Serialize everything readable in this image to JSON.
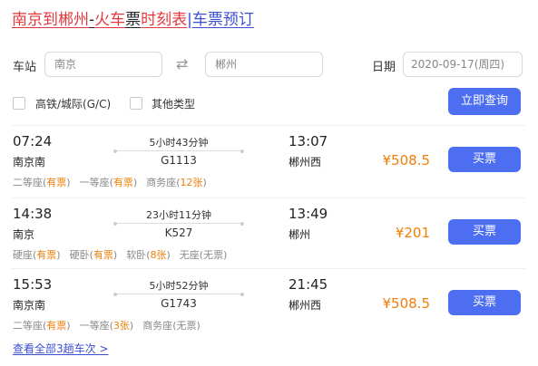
{
  "title": {
    "from": "南京到郴州",
    "dash": "-",
    "huoche": "火车",
    "piao": "票",
    "shikebiao": "时刻表",
    "pipe": "|",
    "booking": "车票预订"
  },
  "search": {
    "station_label": "车站",
    "from_value": "南京",
    "to_value": "郴州",
    "date_label": "日期",
    "date_value": "2020-09-17(周四)",
    "filter_gc": "高铁/城际(G/C)",
    "filter_other": "其他类型",
    "query_button": "立即查询"
  },
  "trains": [
    {
      "depart_time": "07:24",
      "depart_station": "南京南",
      "duration": "5小时43分钟",
      "number": "G1113",
      "arrive_time": "13:07",
      "arrive_station": "郴州西",
      "price": "¥508.5",
      "buy_label": "买票",
      "seats": [
        {
          "name": "二等座",
          "status": "有票"
        },
        {
          "name": "一等座",
          "status": "有票"
        },
        {
          "name": "商务座",
          "status": "12张"
        }
      ]
    },
    {
      "depart_time": "14:38",
      "depart_station": "南京",
      "duration": "23小时11分钟",
      "number": "K527",
      "arrive_time": "13:49",
      "arrive_station": "郴州",
      "price": "¥201",
      "buy_label": "买票",
      "seats": [
        {
          "name": "硬座",
          "status": "有票"
        },
        {
          "name": "硬卧",
          "status": "有票"
        },
        {
          "name": "软卧",
          "status": "8张"
        },
        {
          "name": "无座",
          "status": "无票"
        }
      ]
    },
    {
      "depart_time": "15:53",
      "depart_station": "南京南",
      "duration": "5小时52分钟",
      "number": "G1743",
      "arrive_time": "21:45",
      "arrive_station": "郴州西",
      "price": "¥508.5",
      "buy_label": "买票",
      "seats": [
        {
          "name": "二等座",
          "status": "有票"
        },
        {
          "name": "一等座",
          "status": "3张"
        },
        {
          "name": "商务座",
          "status": "无票"
        }
      ]
    }
  ],
  "view_all": "查看全部3趟车次 >",
  "colors": {
    "accent": "#4e6ef2",
    "price": "#f07d06",
    "title_red": "#e4393c",
    "link_blue": "#3a4ed0"
  }
}
